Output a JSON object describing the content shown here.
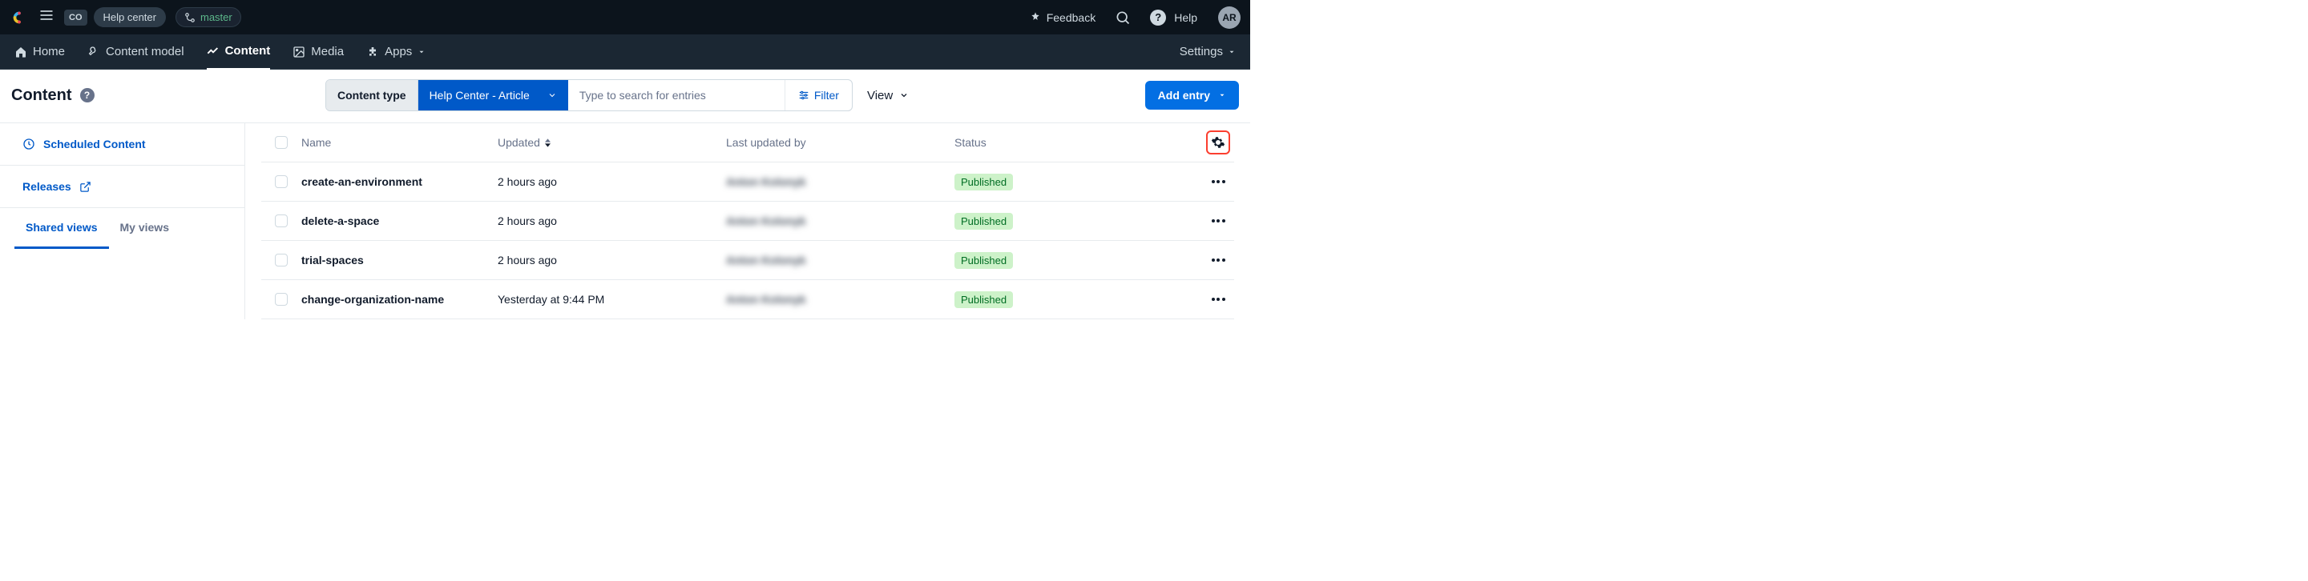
{
  "topbar": {
    "org_code": "CO",
    "space_name": "Help center",
    "branch": "master",
    "feedback_label": "Feedback",
    "help_label": "Help",
    "avatar_initials": "AR"
  },
  "nav": {
    "home": "Home",
    "content_model": "Content model",
    "content": "Content",
    "media": "Media",
    "apps": "Apps",
    "settings": "Settings"
  },
  "page": {
    "title": "Content",
    "content_type_label": "Content type",
    "content_type_value": "Help Center - Article",
    "search_placeholder": "Type to search for entries",
    "filter_label": "Filter",
    "view_label": "View",
    "add_entry_label": "Add entry"
  },
  "sidebar": {
    "scheduled": "Scheduled Content",
    "releases": "Releases",
    "tab_shared": "Shared views",
    "tab_my": "My views"
  },
  "table": {
    "headers": {
      "name": "Name",
      "updated": "Updated",
      "last_updated_by": "Last updated by",
      "status": "Status"
    },
    "rows": [
      {
        "name": "create-an-environment",
        "updated": "2 hours ago",
        "updated_by": "Anton Kolonyk",
        "status": "Published"
      },
      {
        "name": "delete-a-space",
        "updated": "2 hours ago",
        "updated_by": "Anton Kolonyk",
        "status": "Published"
      },
      {
        "name": "trial-spaces",
        "updated": "2 hours ago",
        "updated_by": "Anton Kolonyk",
        "status": "Published"
      },
      {
        "name": "change-organization-name",
        "updated": "Yesterday at 9:44 PM",
        "updated_by": "Anton Kolonyk",
        "status": "Published"
      }
    ]
  }
}
